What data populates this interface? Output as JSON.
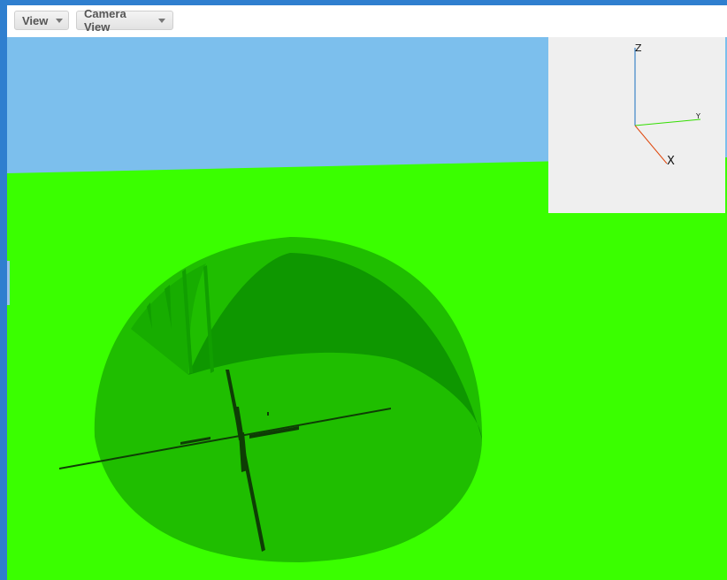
{
  "toolbar": {
    "view_label": "View",
    "camera_view_label": "Camera View"
  },
  "axes": {
    "z_label": "Z",
    "y_label": "Y",
    "x_label": "X"
  },
  "colors": {
    "sky": "#7cbfed",
    "ground": "#3aff00",
    "dome_outer": "#1fbe00",
    "dome_inner": "#0e9700",
    "cross": "#0e3d05",
    "x_axis": "#e04a10",
    "y_axis": "#33dd00",
    "z_axis": "#1a6fbf",
    "inset_bg": "#efefef",
    "frame": "#2f7fcf"
  }
}
